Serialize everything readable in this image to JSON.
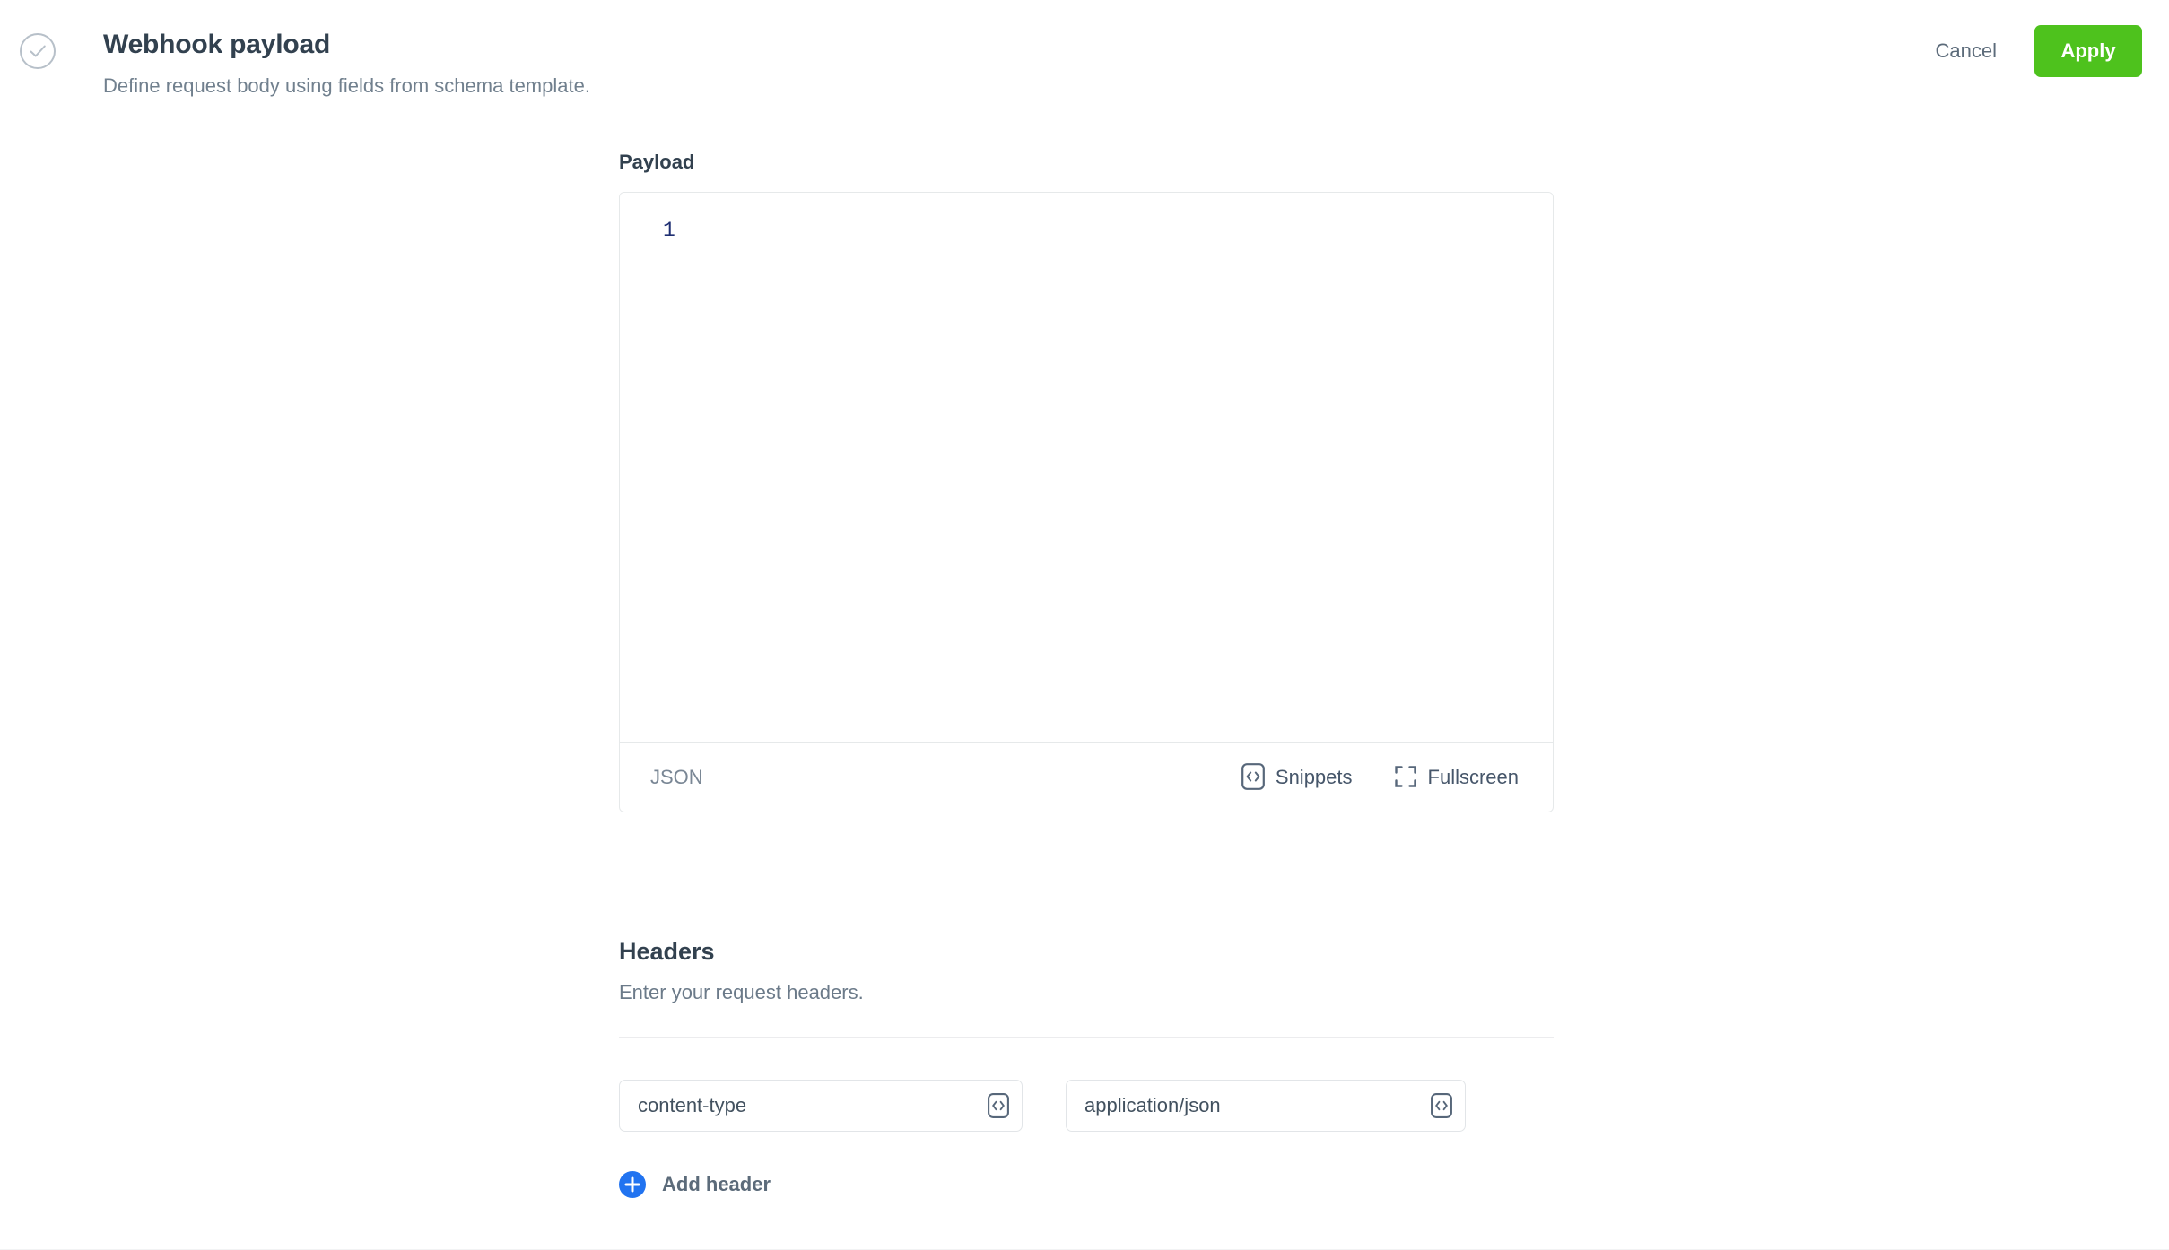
{
  "header": {
    "status_icon": "check-circle-icon",
    "title": "Webhook payload",
    "subtitle": "Define request body using fields from schema template.",
    "cancel_label": "Cancel",
    "apply_label": "Apply",
    "apply_color": "#4ec21d"
  },
  "payload": {
    "label": "Payload",
    "editor": {
      "line_numbers": [
        "1"
      ],
      "content": "",
      "language": "JSON",
      "snippets_label": "Snippets",
      "snippets_icon": "code-brackets-icon",
      "fullscreen_label": "Fullscreen",
      "fullscreen_icon": "fullscreen-icon"
    }
  },
  "headers": {
    "title": "Headers",
    "description": "Enter your request headers.",
    "rows": [
      {
        "key": "content-type",
        "key_placeholder": "content-type",
        "value": "application/json",
        "value_placeholder": "application/json",
        "snippet_icon": "code-brackets-icon"
      }
    ],
    "add_label": "Add header",
    "add_icon": "plus-circle-icon",
    "add_icon_color": "#2173f0"
  }
}
